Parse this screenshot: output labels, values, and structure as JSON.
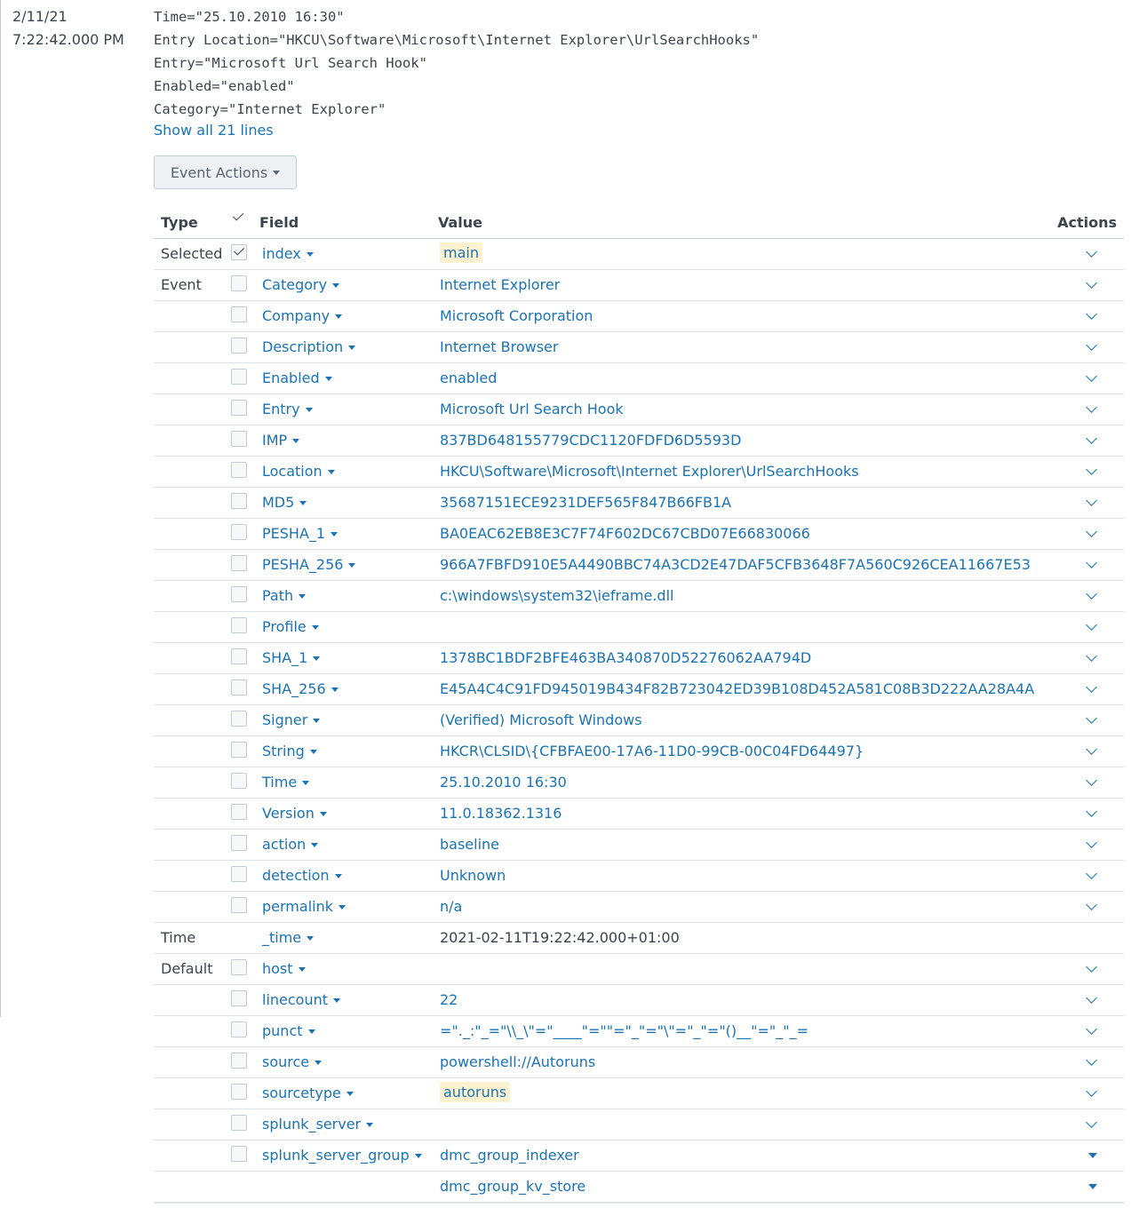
{
  "timestamp": {
    "date": "2/11/21",
    "time": "7:22:42.000 PM"
  },
  "raw_lines": [
    "Time=\"25.10.2010 16:30\"",
    "Entry Location=\"HKCU\\Software\\Microsoft\\Internet Explorer\\UrlSearchHooks\"",
    "Entry=\"Microsoft Url Search Hook\"",
    "Enabled=\"enabled\"",
    "Category=\"Internet Explorer\""
  ],
  "show_all_label": "Show all 21 lines",
  "event_actions_label": "Event Actions",
  "table": {
    "headers": {
      "type": "Type",
      "field": "Field",
      "value": "Value",
      "actions": "Actions"
    },
    "rows": [
      {
        "type": "Selected",
        "field": "index",
        "value": "main",
        "checked": true,
        "highlight": true
      },
      {
        "type": "Event",
        "field": "Category",
        "value": "Internet Explorer"
      },
      {
        "type": "",
        "field": "Company",
        "value": "Microsoft Corporation"
      },
      {
        "type": "",
        "field": "Description",
        "value": "Internet Browser"
      },
      {
        "type": "",
        "field": "Enabled",
        "value": "enabled"
      },
      {
        "type": "",
        "field": "Entry",
        "value": "Microsoft Url Search Hook"
      },
      {
        "type": "",
        "field": "IMP",
        "value": "837BD648155779CDC1120FDFD6D5593D"
      },
      {
        "type": "",
        "field": "Location",
        "value": "HKCU\\Software\\Microsoft\\Internet Explorer\\UrlSearchHooks"
      },
      {
        "type": "",
        "field": "MD5",
        "value": "35687151ECE9231DEF565F847B66FB1A"
      },
      {
        "type": "",
        "field": "PESHA_1",
        "value": "BA0EAC62EB8E3C7F74F602DC67CBD07E66830066"
      },
      {
        "type": "",
        "field": "PESHA_256",
        "value": "966A7FBFD910E5A4490BBC74A3CD2E47DAF5CFB3648F7A560C926CEA11667E53"
      },
      {
        "type": "",
        "field": "Path",
        "value": "c:\\windows\\system32\\ieframe.dll"
      },
      {
        "type": "",
        "field": "Profile",
        "value": ""
      },
      {
        "type": "",
        "field": "SHA_1",
        "value": "1378BC1BDF2BFE463BA340870D52276062AA794D"
      },
      {
        "type": "",
        "field": "SHA_256",
        "value": "E45A4C4C91FD945019B434F82B723042ED39B108D452A581C08B3D222AA28A4A"
      },
      {
        "type": "",
        "field": "Signer",
        "value": "(Verified) Microsoft Windows"
      },
      {
        "type": "",
        "field": "String",
        "value": "HKCR\\CLSID\\{CFBFAE00-17A6-11D0-99CB-00C04FD64497}"
      },
      {
        "type": "",
        "field": "Time",
        "value": "25.10.2010 16:30"
      },
      {
        "type": "",
        "field": "Version",
        "value": "11.0.18362.1316"
      },
      {
        "type": "",
        "field": "action",
        "value": "baseline"
      },
      {
        "type": "",
        "field": "detection",
        "value": "Unknown"
      },
      {
        "type": "",
        "field": "permalink",
        "value": "n/a"
      },
      {
        "type": "Time",
        "field": "_time",
        "value": "2021-02-11T19:22:42.000+01:00",
        "nocheck": true,
        "plain": true,
        "noaction": true
      },
      {
        "type": "Default",
        "field": "host",
        "value": ""
      },
      {
        "type": "",
        "field": "linecount",
        "value": "22"
      },
      {
        "type": "",
        "field": "punct",
        "value": "=\"._:\"_=\"\\\\_\\\"=\"____\"=\"\"=\"_\"=\"\\\"=\"_\"=\"()__\"=\"_\"_="
      },
      {
        "type": "",
        "field": "source",
        "value": "powershell://Autoruns"
      },
      {
        "type": "",
        "field": "sourcetype",
        "value": "autoruns",
        "highlight": true
      },
      {
        "type": "",
        "field": "splunk_server",
        "value": ""
      },
      {
        "type": "",
        "field": "splunk_server_group",
        "value": "dmc_group_indexer",
        "triangle": true
      },
      {
        "type": "",
        "field": "",
        "value": "dmc_group_kv_store",
        "nocheck": true,
        "triangle": true,
        "last": true
      }
    ]
  }
}
